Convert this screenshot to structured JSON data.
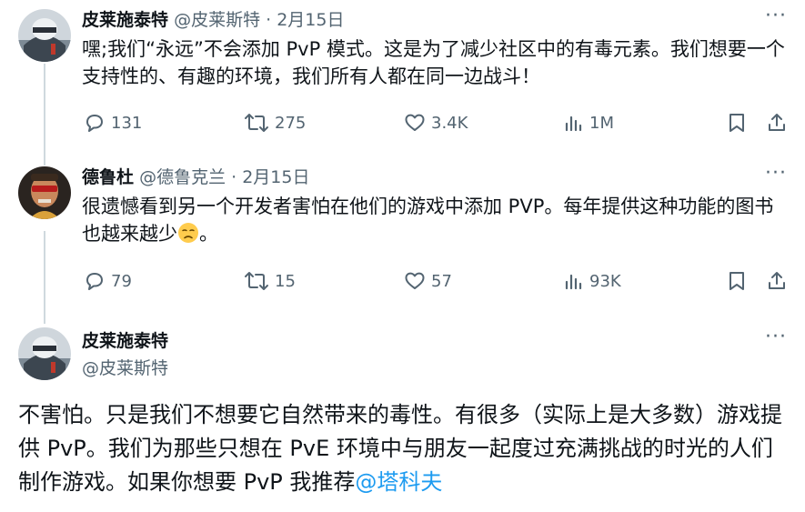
{
  "tweets": [
    {
      "author": "皮莱施泰特",
      "handle": "@皮莱斯特",
      "separator": "·",
      "date": "2月15日",
      "more": "···",
      "text": "嘿;我们“永远”不会添加 PvP 模式。这是为了减少社区中的有毒元素。我们想要一个支持性的、有趣的环境，我们所有人都在同一边战斗！",
      "replies": "131",
      "reposts": "275",
      "likes": "3.4K",
      "views": "1M"
    },
    {
      "author": "德鲁杜",
      "handle": "@德鲁克兰",
      "separator": "·",
      "date": "2月15日",
      "more": "···",
      "text": "很遗憾看到另一个开发者害怕在他们的游戏中添加 PVP。每年提供这种功能的图书也越来越少",
      "text_suffix": "。",
      "emoji": "disappointed-face",
      "replies": "79",
      "reposts": "15",
      "likes": "57",
      "views": "93K"
    }
  ],
  "main_tweet": {
    "author": "皮莱施泰特",
    "handle": "@皮莱斯特",
    "more": "···",
    "text": "不害怕。只是我们不想要它自然带来的毒性。有很多（实际上是大多数）游戏提供 PvP。我们为那些只想在 PvE 环境中与朋友一起度过充满挑战的时光的人们制作游戏。如果你想要 PvP 我推荐",
    "mention": "@塔科夫"
  },
  "colors": {
    "text": "#0f1419",
    "secondary": "#536471",
    "link": "#1d9bf0",
    "thread_line": "#cfd9de"
  }
}
